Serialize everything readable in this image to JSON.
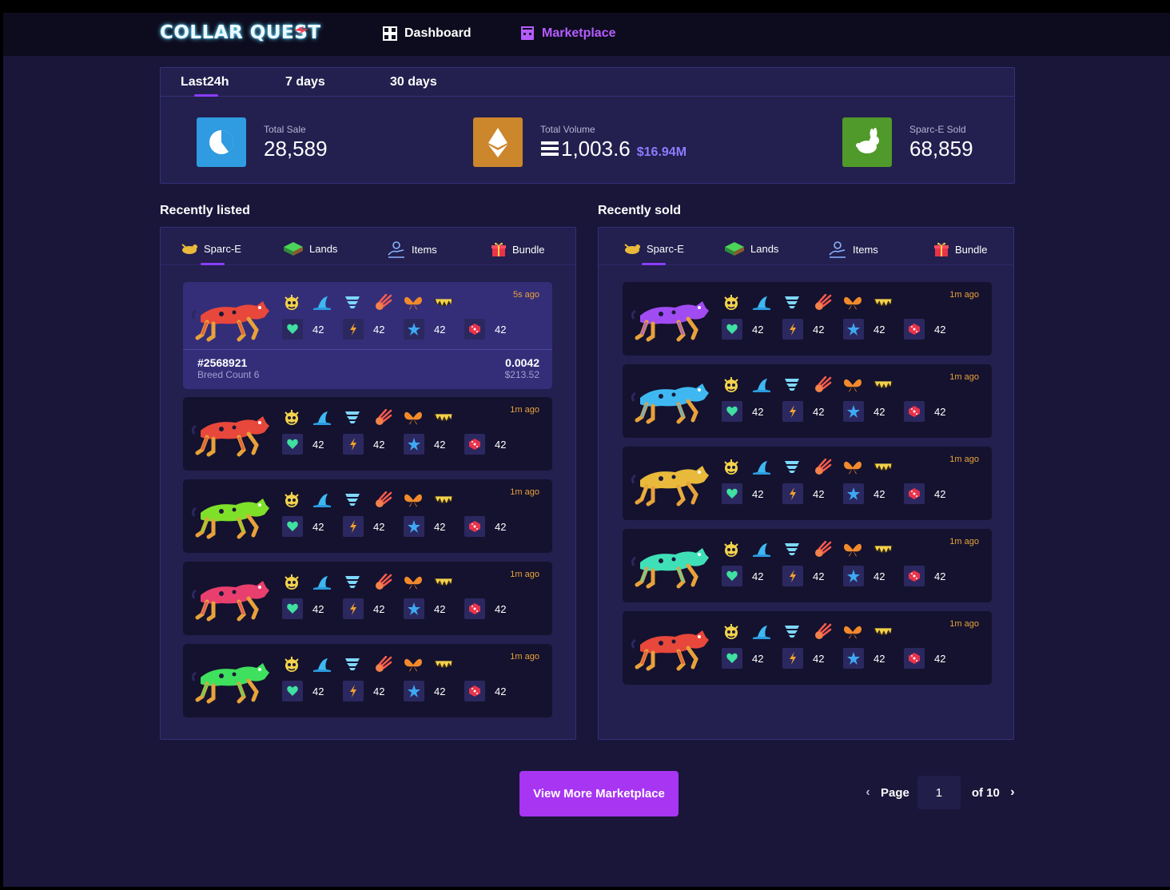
{
  "header": {
    "logo": "COLLAR QUEST",
    "nav": [
      {
        "label": "Dashboard",
        "icon": "grid-icon"
      },
      {
        "label": "Marketplace",
        "icon": "shop-icon",
        "active": true
      }
    ]
  },
  "stats": {
    "tabs": [
      "Last24h",
      "7 days",
      "30 days"
    ],
    "active_tab": "Last24h",
    "total_sale": {
      "label": "Total Sale",
      "value": "28,589",
      "color": "#2f9be0",
      "icon": "pie-chart-icon"
    },
    "total_volume": {
      "label": "Total Volume",
      "value": "1,003.6",
      "usd": "$16.94M",
      "color": "#cc862c",
      "icon": "ethereum-icon"
    },
    "sold": {
      "label": "Sparc-E Sold",
      "value": "68,859",
      "color": "#4f9a2a",
      "icon": "rabbit-icon"
    }
  },
  "recently_listed": {
    "title": "Recently listed",
    "tabs": [
      "Sparc-E",
      "Lands",
      "Items",
      "Bundle"
    ],
    "cards": [
      {
        "time": "5s ago",
        "dog_color": "#e8473b",
        "id": "#2568921",
        "breed": "Breed Count 6",
        "price": "0.0042",
        "price_usd": "$213.52",
        "stats": [
          "42",
          "42",
          "42",
          "42"
        ]
      },
      {
        "time": "1m ago",
        "dog_color": "#e8473b",
        "stats": [
          "42",
          "42",
          "42",
          "42"
        ]
      },
      {
        "time": "1m ago",
        "dog_color": "#7fe02a",
        "stats": [
          "42",
          "42",
          "42",
          "42"
        ]
      },
      {
        "time": "1m ago",
        "dog_color": "#e83f6e",
        "stats": [
          "42",
          "42",
          "42",
          "42"
        ]
      },
      {
        "time": "1m ago",
        "dog_color": "#3fe05e",
        "stats": [
          "42",
          "42",
          "42",
          "42"
        ]
      }
    ]
  },
  "recently_sold": {
    "title": "Recently sold",
    "tabs": [
      "Sparc-E",
      "Lands",
      "Items",
      "Bundle"
    ],
    "cards": [
      {
        "time": "1m ago",
        "dog_color": "#a04cf2",
        "stats": [
          "42",
          "42",
          "42",
          "42"
        ]
      },
      {
        "time": "1m ago",
        "dog_color": "#3fb8f2",
        "stats": [
          "42",
          "42",
          "42",
          "42"
        ]
      },
      {
        "time": "1m ago",
        "dog_color": "#e8b93b",
        "stats": [
          "42",
          "42",
          "42",
          "42"
        ]
      },
      {
        "time": "1m ago",
        "dog_color": "#3fe0b8",
        "stats": [
          "42",
          "42",
          "42",
          "42"
        ]
      },
      {
        "time": "1m ago",
        "dog_color": "#e8473b",
        "stats": [
          "42",
          "42",
          "42",
          "42"
        ]
      }
    ]
  },
  "footer": {
    "view_more": "View More Marketplace",
    "page_label": "Page",
    "page_value": "1",
    "page_of": "of 10"
  },
  "colors": {
    "accent": "#a735f2",
    "background": "#19163a",
    "panel": "#231f4e",
    "time_text": "#e8a23b"
  }
}
